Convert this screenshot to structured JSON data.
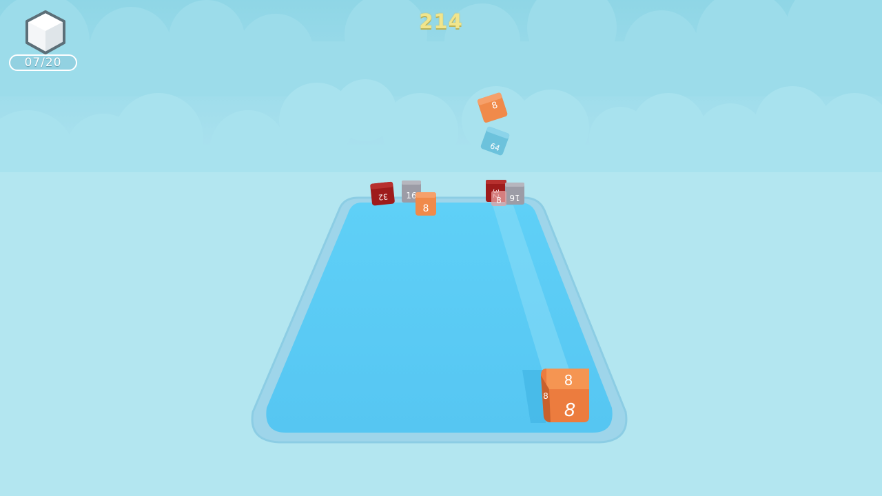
{
  "hud": {
    "score": "214",
    "progress": "07/20"
  },
  "colors": {
    "sky_top": "#8fd6e6",
    "sky_bottom": "#b5e7f1",
    "board": "#5ecdf6",
    "board_rim": "#96d4ec",
    "score": "#f1e58c",
    "cube_8": "#f08a4a",
    "cube_16": "#9c9ca6",
    "cube_32": "#9e1b1b",
    "cube_64": "#6cc2dc"
  },
  "cubes": {
    "player": "8",
    "far_left_red": "32",
    "far_left_gray": "16",
    "far_left_orange": "8",
    "far_right_red": "32",
    "far_right_gray": "16",
    "far_right_small": "8",
    "air_orange": "8",
    "air_blue": "64"
  },
  "icons": {
    "cube_counter": "white-cube-icon"
  }
}
